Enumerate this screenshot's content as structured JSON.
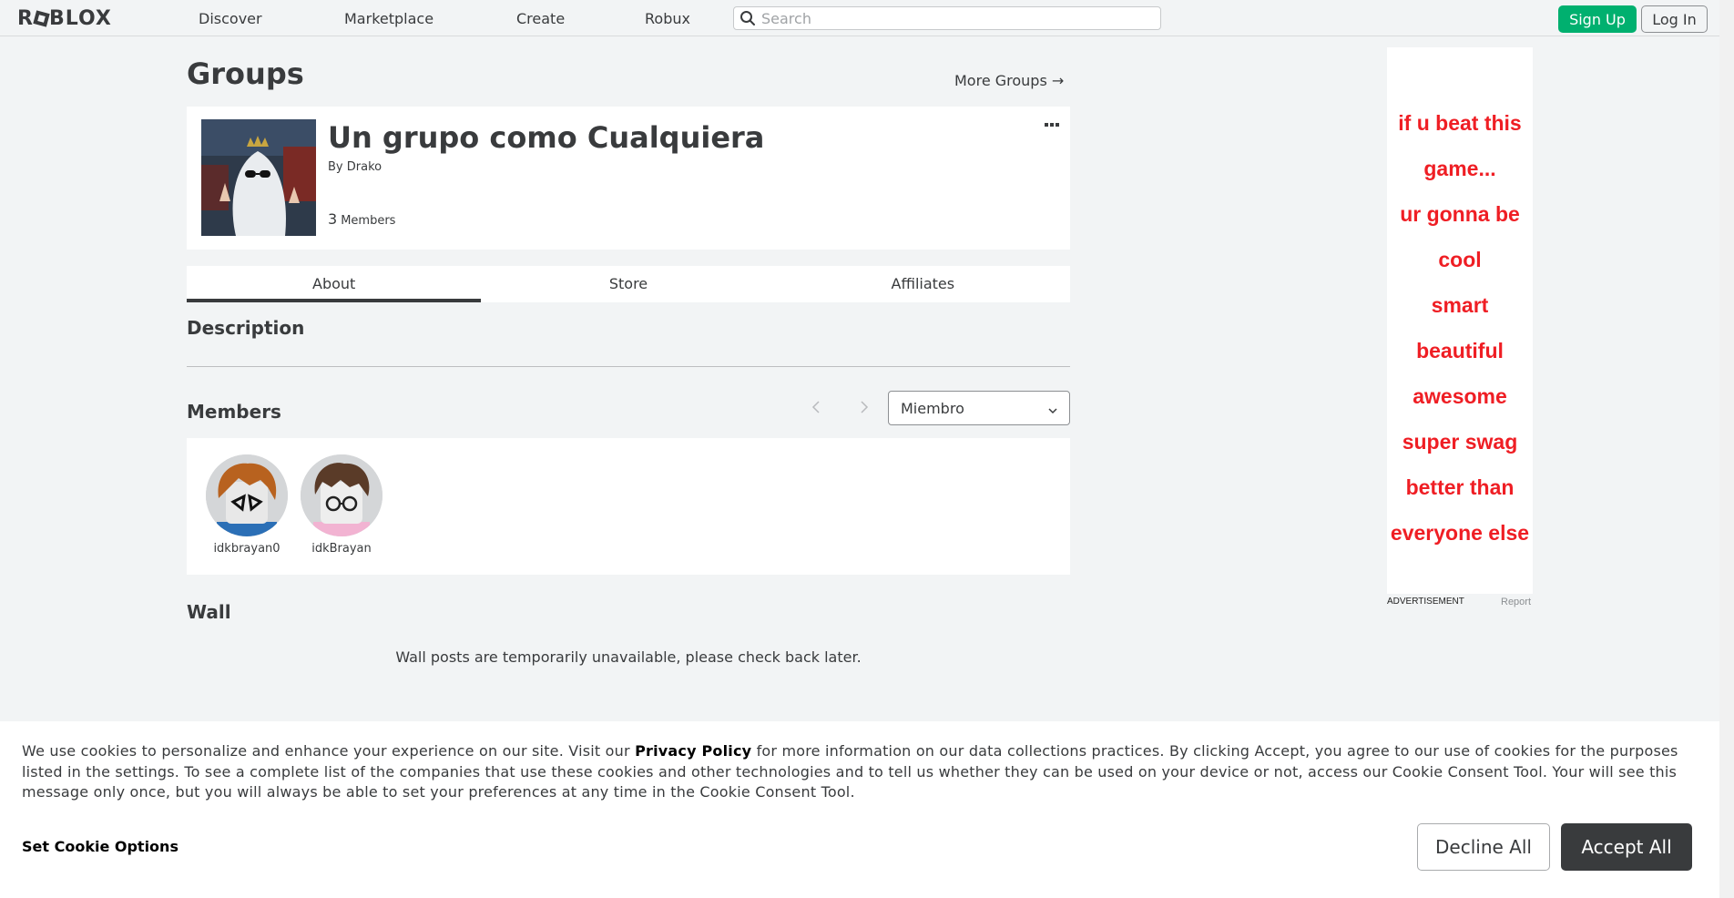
{
  "nav": {
    "logo": "ROBLOX",
    "links": [
      "Discover",
      "Marketplace",
      "Create",
      "Robux"
    ],
    "search_placeholder": "Search",
    "signup_label": "Sign Up",
    "login_label": "Log In"
  },
  "page": {
    "title": "Groups",
    "more_groups": "More Groups →"
  },
  "group": {
    "name": "Un grupo como Cualquiera",
    "by_prefix": "By",
    "owner": "Drako",
    "member_count": "3",
    "members_label": "Members"
  },
  "tabs": [
    "About",
    "Store",
    "Affiliates"
  ],
  "about": {
    "description_heading": "Description",
    "members_heading": "Members",
    "role_selected": "Miembro",
    "members": [
      {
        "name": "idkbrayan0"
      },
      {
        "name": "idkBrayan"
      }
    ],
    "wall_heading": "Wall",
    "wall_message": "Wall posts are temporarily unavailable, please check back later."
  },
  "ad": {
    "lines": [
      "if u beat this",
      "game...",
      "ur gonna be",
      "cool",
      "smart",
      "beautiful",
      "awesome",
      "super swag",
      "better than",
      "everyone else"
    ],
    "label": "ADVERTISEMENT",
    "report": "Report",
    "text_color": "#ef1e24"
  },
  "cookie": {
    "text_before": "We use cookies to personalize and enhance your experience on our site. Visit our ",
    "privacy_link": "Privacy Policy",
    "text_after": " for more information on our data collections practices. By clicking Accept, you agree to our use of cookies for the purposes listed in the settings. To see a complete list of the companies that use these cookies and other technologies and to tell us whether they can be used on your device or not, access our Cookie Consent Tool. Your will see this message only once, but you will always be able to set your preferences at any time in the Cookie Consent Tool.",
    "options_label": "Set Cookie Options",
    "decline_label": "Decline All",
    "accept_label": "Accept All"
  },
  "colors": {
    "brand_green": "#00b06f",
    "text": "#393b3d",
    "background": "#f2f4f5"
  }
}
